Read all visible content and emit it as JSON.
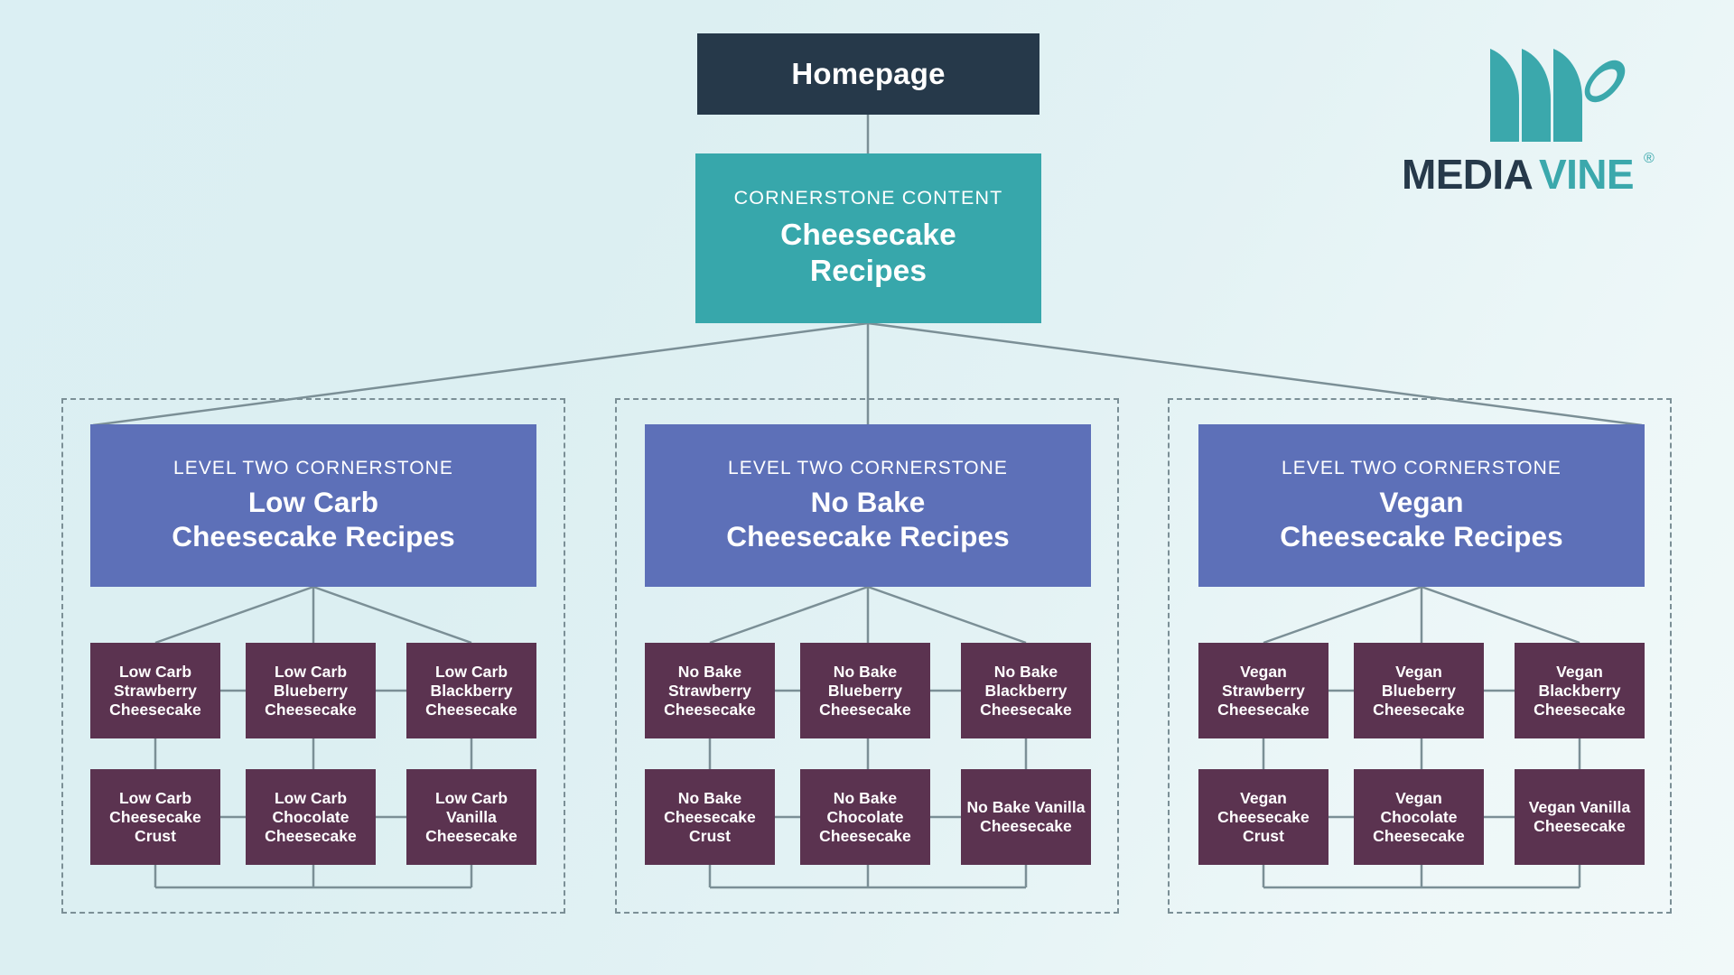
{
  "brand": {
    "name": "MEDIAVINE",
    "name_part_dark": "MEDIA",
    "name_part_teal": "VINE",
    "registered_mark": "®",
    "logo_color": "#3ba8ac",
    "wordmark_dark_color": "#26394a"
  },
  "palette": {
    "background_start": "#dbeff3",
    "background_end": "#f1f9f9",
    "homepage_box": "#26394a",
    "cornerstone_box": "#37a7ab",
    "level_two_box": "#5d70b8",
    "leaf_box": "#5b3350",
    "connector_line": "#7b8f96",
    "dashed_border": "#7b8f96",
    "text_on_box": "#ffffff"
  },
  "diagram": {
    "type": "site-architecture-tree",
    "root": {
      "label": "Homepage"
    },
    "cornerstone": {
      "kicker": "CORNERSTONE CONTENT",
      "title_line1": "Cheesecake",
      "title_line2": "Recipes"
    },
    "groups": [
      {
        "kicker": "LEVEL TWO CORNERSTONE",
        "title_line1": "Low Carb",
        "title_line2": "Cheesecake Recipes",
        "children_row1": [
          "Low Carb Strawberry Cheesecake",
          "Low Carb Blueberry Cheesecake",
          "Low Carb Blackberry Cheesecake"
        ],
        "children_row2": [
          "Low Carb Cheesecake Crust",
          "Low Carb Chocolate Cheesecake",
          "Low Carb Vanilla Cheesecake"
        ]
      },
      {
        "kicker": "LEVEL TWO CORNERSTONE",
        "title_line1": "No Bake",
        "title_line2": "Cheesecake Recipes",
        "children_row1": [
          "No Bake Strawberry Cheesecake",
          "No Bake Blueberry Cheesecake",
          "No Bake Blackberry Cheesecake"
        ],
        "children_row2": [
          "No Bake Cheesecake Crust",
          "No Bake Chocolate Cheesecake",
          "No Bake Vanilla Cheesecake"
        ]
      },
      {
        "kicker": "LEVEL TWO CORNERSTONE",
        "title_line1": "Vegan",
        "title_line2": "Cheesecake Recipes",
        "children_row1": [
          "Vegan Strawberry Cheesecake",
          "Vegan Blueberry Cheesecake",
          "Vegan Blackberry Cheesecake"
        ],
        "children_row2": [
          "Vegan Cheesecake Crust",
          "Vegan Chocolate Cheesecake",
          "Vegan Vanilla Cheesecake"
        ]
      }
    ]
  }
}
